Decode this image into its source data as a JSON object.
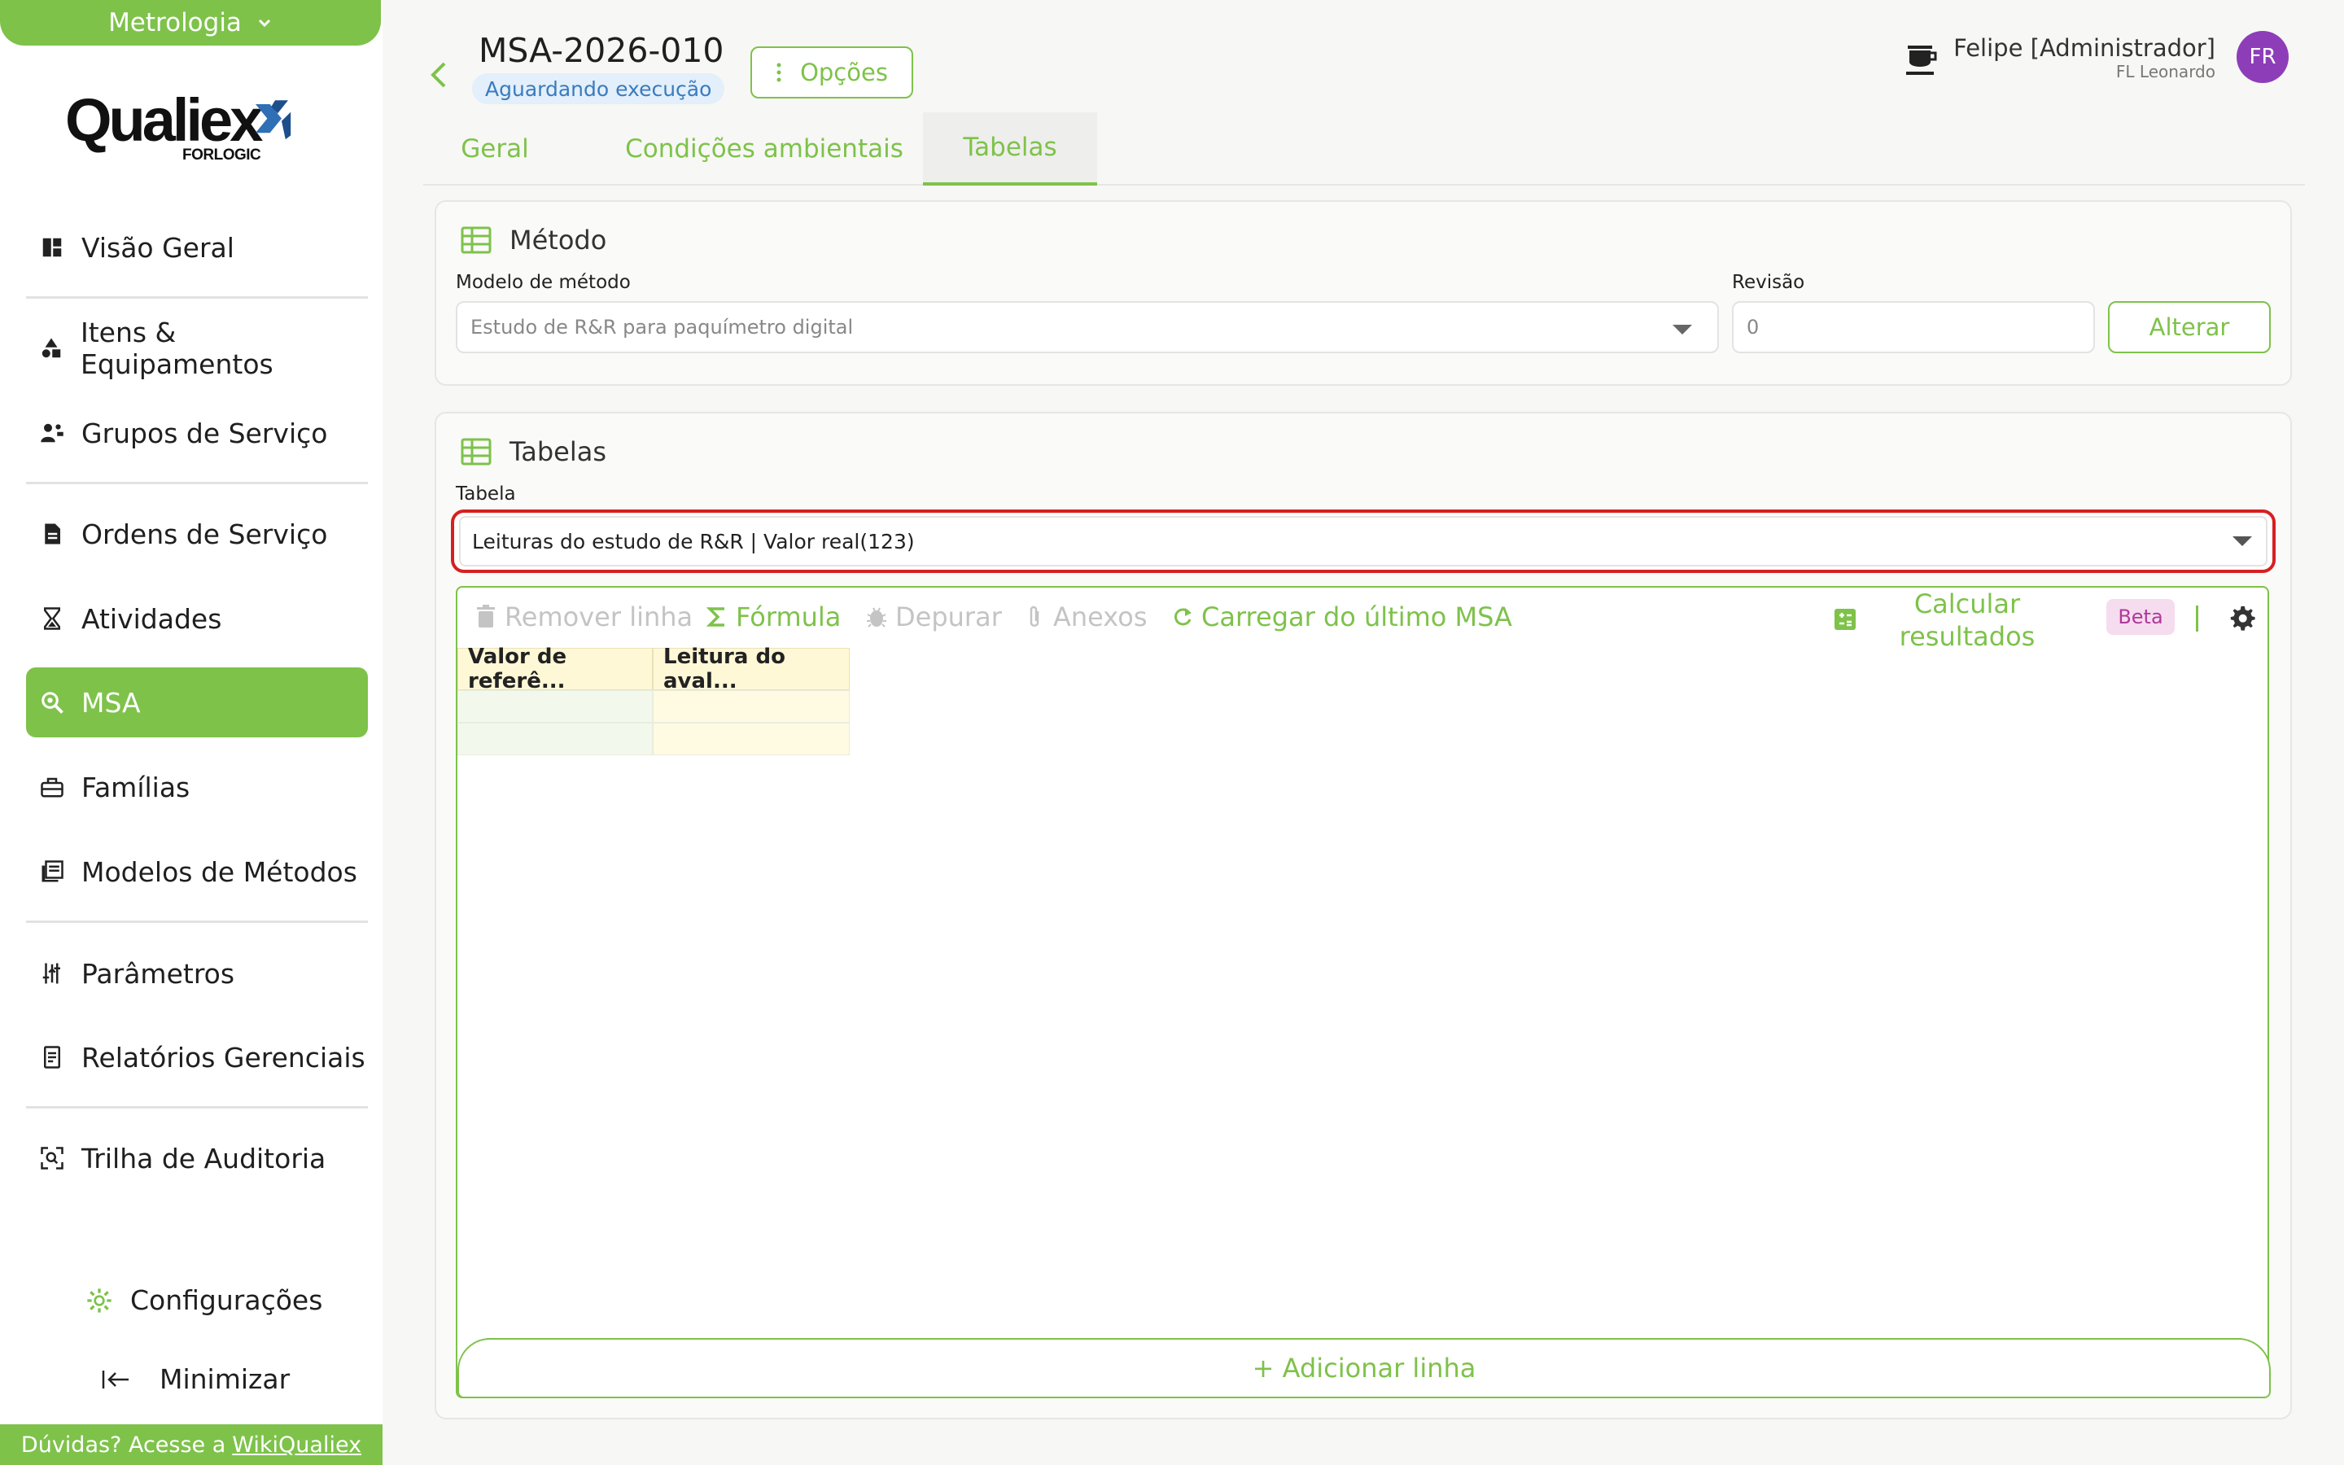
{
  "sidebar": {
    "module": "Metrologia",
    "logo_text": "Qualiex",
    "logo_sub": "FORLOGIC",
    "items": [
      {
        "label": "Visão Geral",
        "icon": "dashboard-icon"
      },
      {
        "label": "Itens & Equipamentos",
        "icon": "shapes-icon"
      },
      {
        "label": "Grupos de Serviço",
        "icon": "group-icon"
      },
      {
        "label": "Ordens de Serviço",
        "icon": "document-icon"
      },
      {
        "label": "Atividades",
        "icon": "hourglass-icon"
      },
      {
        "label": "MSA",
        "icon": "magnify-icon"
      },
      {
        "label": "Famílias",
        "icon": "toolbox-icon"
      },
      {
        "label": "Modelos de Métodos",
        "icon": "library-icon"
      },
      {
        "label": "Parâmetros",
        "icon": "sliders-icon"
      },
      {
        "label": "Relatórios Gerenciais",
        "icon": "report-icon"
      },
      {
        "label": "Trilha de Auditoria",
        "icon": "scan-icon"
      }
    ],
    "config_label": "Configurações",
    "minimize_label": "Minimizar",
    "help_prefix": "Dúvidas? Acesse a",
    "help_link": "WikiQualiex"
  },
  "header": {
    "title": "MSA-2026-010",
    "status": "Aguardando execução",
    "options_label": "Opções",
    "user_name": "Felipe [Administrador]",
    "user_company": "FL Leonardo",
    "avatar_initials": "FR"
  },
  "tabs": [
    {
      "label": "Geral",
      "active": false
    },
    {
      "label": "Condições ambientais",
      "active": false
    },
    {
      "label": "Tabelas",
      "active": true
    }
  ],
  "method_panel": {
    "title": "Método",
    "model_label": "Modelo de método",
    "model_value": "Estudo de R&R para paquímetro digital",
    "revision_label": "Revisão",
    "revision_value": "0",
    "alter_label": "Alterar"
  },
  "tables_panel": {
    "title": "Tabelas",
    "table_label": "Tabela",
    "table_value": "Leituras do estudo de R&R | Valor real(123)",
    "toolbar": {
      "remove_row": "Remover linha",
      "formula": "Fórmula",
      "debug": "Depurar",
      "attachments": "Anexos",
      "load_last": "Carregar do último MSA",
      "calculate": "Calcular resultados",
      "beta": "Beta"
    },
    "columns": [
      "Valor de referê...",
      "Leitura do aval..."
    ],
    "add_row_label": "+ Adicionar linha"
  },
  "colors": {
    "accent": "#7ec24a",
    "highlight_border": "#d62020",
    "avatar": "#8e3db9",
    "status_bg": "#e3effa",
    "status_text": "#3a7bbf"
  }
}
